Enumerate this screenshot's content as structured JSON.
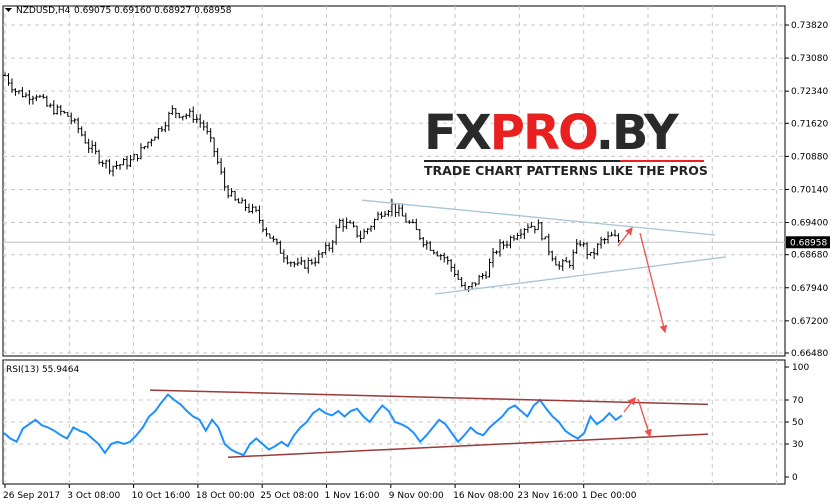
{
  "header": {
    "symbol": "NZDUSD,H4",
    "ohlc": "0.69075 0.69160 0.68927 0.68958"
  },
  "watermark": {
    "brand_dark_1": "FX",
    "brand_red": "PRO",
    "brand_dark_2": ".BY",
    "tagline": "TRADE CHART PATTERNS LIKE THE PROS"
  },
  "colors": {
    "rsi": "#1e90ff",
    "trend_price": "#a8c4d8",
    "trend_rsi": "#9b3a3a",
    "arrow": "#f0504a",
    "grid": "#c8c8c8"
  },
  "chart_data": [
    {
      "type": "line",
      "title": "NZDUSD,H4",
      "subtype": "ohlc-bars",
      "current_price": "0.68958",
      "y_ticks": [
        "0.73820",
        "0.73080",
        "0.72340",
        "0.71620",
        "0.70880",
        "0.70140",
        "0.69400",
        "0.68680",
        "0.67940",
        "0.67200",
        "0.66480"
      ],
      "ylim": [
        0.6648,
        0.7382
      ],
      "x_ticks": [
        "26 Sep 2017",
        "3 Oct 08:00",
        "10 Oct 16:00",
        "18 Oct 00:00",
        "25 Oct 08:00",
        "1 Nov 16:00",
        "9 Nov 00:00",
        "16 Nov 08:00",
        "23 Nov 16:00",
        "1 Dec 00:00"
      ],
      "closes": [
        0.7269,
        0.7235,
        0.7224,
        0.7228,
        0.72,
        0.719,
        0.7179,
        0.715,
        0.7111,
        0.7085,
        0.7066,
        0.707,
        0.7077,
        0.71,
        0.713,
        0.7156,
        0.719,
        0.7182,
        0.7179,
        0.7156,
        0.71,
        0.7021,
        0.6987,
        0.6976,
        0.696,
        0.692,
        0.6886,
        0.686,
        0.6841,
        0.685,
        0.6863,
        0.6886,
        0.6942,
        0.6931,
        0.6908,
        0.6935,
        0.6965,
        0.6978,
        0.6953,
        0.693,
        0.69,
        0.688,
        0.6862,
        0.6829,
        0.6784,
        0.6807,
        0.6829,
        0.688,
        0.6897,
        0.692,
        0.6935,
        0.6931,
        0.688,
        0.6841,
        0.6852,
        0.6897,
        0.6863,
        0.6897,
        0.6908,
        0.6896
      ],
      "annotations": {
        "trend_upper": [
          0.699,
          0.6912
        ],
        "trend_lower": [
          0.678,
          0.6863
        ],
        "arrow_up_to": 0.694,
        "arrow_down_to": 0.6695
      }
    },
    {
      "type": "line",
      "title": "RSI(13) 55.9464",
      "y_ticks": [
        "100",
        "70",
        "50",
        "30",
        "0"
      ],
      "ylim": [
        0,
        100
      ],
      "values": [
        40,
        35,
        32,
        44,
        48,
        52,
        47,
        45,
        42,
        38,
        35,
        45,
        42,
        40,
        35,
        30,
        22,
        30,
        32,
        30,
        32,
        38,
        45,
        55,
        60,
        68,
        75,
        70,
        66,
        60,
        55,
        52,
        42,
        52,
        45,
        30,
        25,
        22,
        20,
        30,
        35,
        30,
        25,
        28,
        32,
        28,
        38,
        45,
        50,
        58,
        62,
        58,
        56,
        60,
        55,
        60,
        62,
        55,
        50,
        58,
        65,
        60,
        50,
        48,
        45,
        40,
        32,
        38,
        45,
        52,
        48,
        40,
        32,
        38,
        45,
        40,
        38,
        45,
        50,
        55,
        62,
        65,
        60,
        55,
        65,
        70,
        62,
        55,
        50,
        42,
        38,
        35,
        40,
        55,
        48,
        52,
        58,
        52,
        56
      ],
      "annotations": {
        "trend_upper": [
          79,
          66
        ],
        "trend_lower": [
          18,
          39
        ]
      }
    }
  ]
}
